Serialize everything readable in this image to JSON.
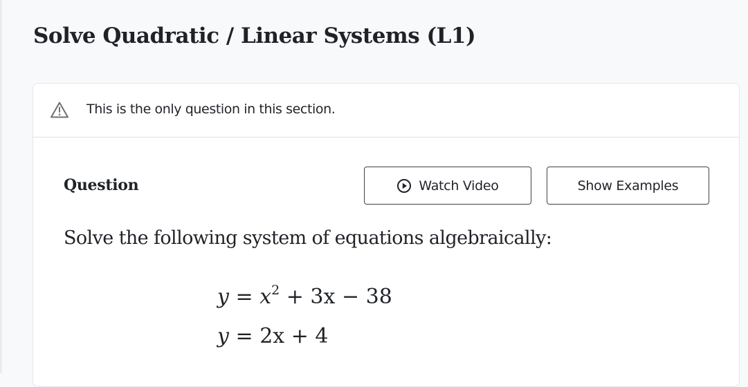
{
  "page": {
    "title": "Solve Quadratic / Linear Systems (L1)"
  },
  "notice": {
    "icon": "warning-triangle-icon",
    "text": "This is the only question in this section."
  },
  "question": {
    "label": "Question",
    "watch_video_label": "Watch Video",
    "watch_video_icon": "play-circle-icon",
    "show_examples_label": "Show Examples",
    "prompt": "Solve the following system of equations algebraically:",
    "equations": [
      {
        "lhs": "y",
        "rel": "=",
        "rhs_var": "x",
        "rhs_exp": "2",
        "rhs_rest": "+ 3x − 38"
      },
      {
        "lhs": "y",
        "rel": "=",
        "rhs": "2x + 4"
      }
    ]
  },
  "colors": {
    "background": "#f8f9fb",
    "card": "#ffffff",
    "text": "#1f2328",
    "border": "#3c4043"
  }
}
